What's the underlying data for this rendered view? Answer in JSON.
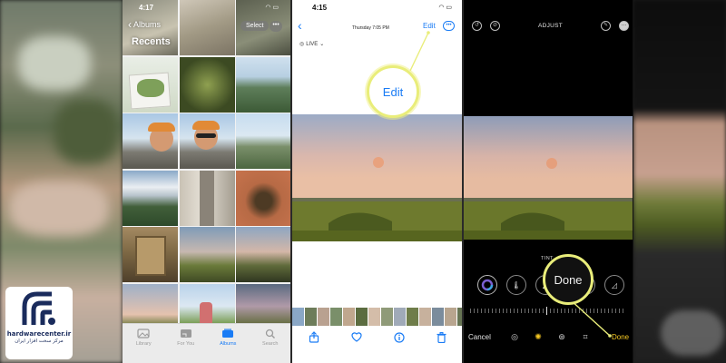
{
  "colors": {
    "ios_blue": "#1a7cf5",
    "highlight_yellow": "#e9ed7a",
    "done_yellow": "#f5c722",
    "logo_navy": "#1a2b5c"
  },
  "screen_albums": {
    "status_time": "4:17",
    "back_label": "Albums",
    "select_button": "Select",
    "more_button": "•••",
    "title": "Recents",
    "tabs": [
      {
        "label": "Library",
        "icon": "photo-library-icon"
      },
      {
        "label": "For You",
        "icon": "for-you-icon"
      },
      {
        "label": "Albums",
        "icon": "albums-icon",
        "active": true
      },
      {
        "label": "Search",
        "icon": "search-icon"
      }
    ]
  },
  "screen_photo": {
    "status_time": "4:15",
    "date_label": "Thursday  7:05 PM",
    "edit_button": "Edit",
    "more_button": "•••",
    "live_label": "LIVE",
    "zoom_callout": "Edit",
    "toolbar": [
      "share-icon",
      "favorite-heart-icon",
      "info-icon",
      "trash-icon"
    ]
  },
  "screen_adjust": {
    "title": "ADJUST",
    "tint_label": "TINT",
    "cancel_button": "Cancel",
    "done_button": "Done",
    "zoom_callout": "Done"
  },
  "logo": {
    "name": "hardwarecenter.ir",
    "subtitle": "مرکز سخت افزار ایران"
  }
}
